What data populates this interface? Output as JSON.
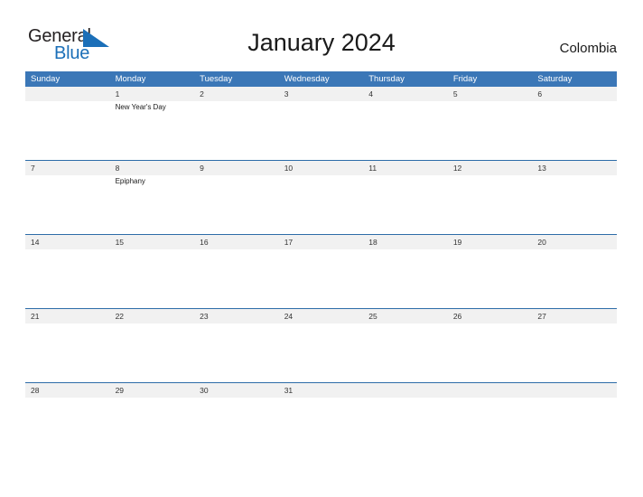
{
  "brand": {
    "name_part1": "General",
    "name_part2": "Blue",
    "flag_icon": "blue-triangle-flag-icon",
    "color_dark": "#231f20",
    "color_blue": "#1b6fb8"
  },
  "header": {
    "title": "January 2024",
    "country": "Colombia"
  },
  "theme": {
    "header_blue": "#3b77b7",
    "row_border_blue": "#2d6ca8",
    "band_gray": "#f1f1f1",
    "page_background": "#ffffff",
    "date_text": "#333333"
  },
  "calendar": {
    "month": "January",
    "year": "2024",
    "weekdays": [
      "Sunday",
      "Monday",
      "Tuesday",
      "Wednesday",
      "Thursday",
      "Friday",
      "Saturday"
    ],
    "weeks": [
      {
        "days": [
          {
            "num": "",
            "event": ""
          },
          {
            "num": "1",
            "event": "New Year's Day"
          },
          {
            "num": "2",
            "event": ""
          },
          {
            "num": "3",
            "event": ""
          },
          {
            "num": "4",
            "event": ""
          },
          {
            "num": "5",
            "event": ""
          },
          {
            "num": "6",
            "event": ""
          }
        ]
      },
      {
        "days": [
          {
            "num": "7",
            "event": ""
          },
          {
            "num": "8",
            "event": "Epiphany"
          },
          {
            "num": "9",
            "event": ""
          },
          {
            "num": "10",
            "event": ""
          },
          {
            "num": "11",
            "event": ""
          },
          {
            "num": "12",
            "event": ""
          },
          {
            "num": "13",
            "event": ""
          }
        ]
      },
      {
        "days": [
          {
            "num": "14",
            "event": ""
          },
          {
            "num": "15",
            "event": ""
          },
          {
            "num": "16",
            "event": ""
          },
          {
            "num": "17",
            "event": ""
          },
          {
            "num": "18",
            "event": ""
          },
          {
            "num": "19",
            "event": ""
          },
          {
            "num": "20",
            "event": ""
          }
        ]
      },
      {
        "days": [
          {
            "num": "21",
            "event": ""
          },
          {
            "num": "22",
            "event": ""
          },
          {
            "num": "23",
            "event": ""
          },
          {
            "num": "24",
            "event": ""
          },
          {
            "num": "25",
            "event": ""
          },
          {
            "num": "26",
            "event": ""
          },
          {
            "num": "27",
            "event": ""
          }
        ]
      },
      {
        "days": [
          {
            "num": "28",
            "event": ""
          },
          {
            "num": "29",
            "event": ""
          },
          {
            "num": "30",
            "event": ""
          },
          {
            "num": "31",
            "event": ""
          },
          {
            "num": "",
            "event": ""
          },
          {
            "num": "",
            "event": ""
          },
          {
            "num": "",
            "event": ""
          }
        ]
      }
    ]
  }
}
